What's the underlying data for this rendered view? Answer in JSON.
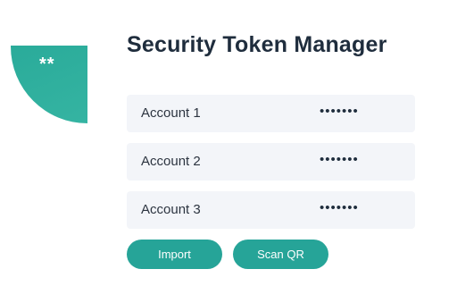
{
  "logo": {
    "text": "**"
  },
  "header": {
    "title": "Security Token Manager"
  },
  "accounts": [
    {
      "name": "Account 1",
      "token": "•••••••"
    },
    {
      "name": "Account 2",
      "token": "•••••••"
    },
    {
      "name": "Account 3",
      "token": "•••••••"
    }
  ],
  "actions": {
    "import_label": "Import",
    "scan_label": "Scan QR"
  },
  "colors": {
    "accent": "#26a498",
    "title": "#1f2d3d",
    "row_background": "#f3f5f9"
  }
}
